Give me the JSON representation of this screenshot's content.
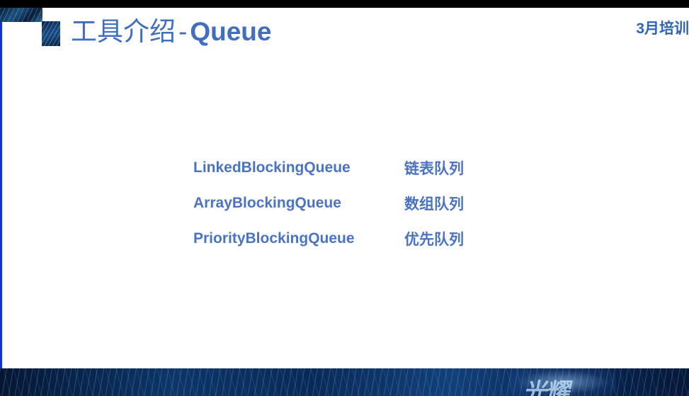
{
  "header": {
    "title_main": "工具介绍",
    "title_separator": "-",
    "title_keyword": "Queue",
    "badge": "3月培训"
  },
  "queues": [
    {
      "name": "LinkedBlockingQueue",
      "description": "链表队列"
    },
    {
      "name": "ArrayBlockingQueue",
      "description": "数组队列"
    },
    {
      "name": "PriorityBlockingQueue",
      "description": "优先队列"
    }
  ],
  "footer": {
    "watermark": "光耀"
  },
  "colors": {
    "accent": "#3f6fbe",
    "text": "#4a73c2",
    "edge": "#1433d6"
  }
}
